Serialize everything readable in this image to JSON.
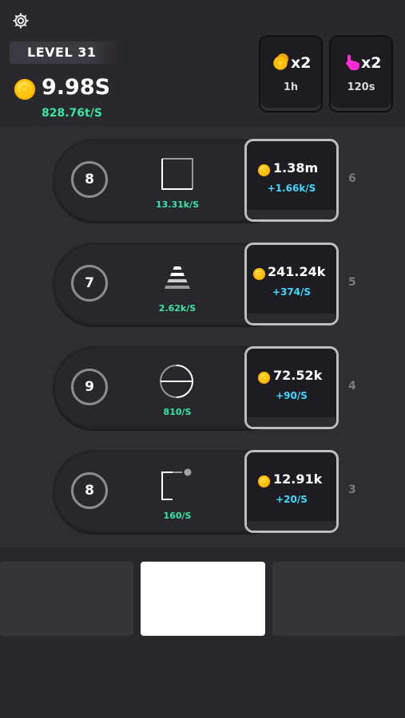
{
  "header": {
    "level": "LEVEL 31",
    "money": "9.98S",
    "rate": "828.76t/S"
  },
  "boosts": [
    {
      "multiplier": "x2",
      "time": "1h",
      "icon": "coin-stack-icon"
    },
    {
      "multiplier": "x2",
      "time": "120s",
      "icon": "tap-hand-icon"
    }
  ],
  "rows": [
    {
      "count": "8",
      "rate": "13.31k/S",
      "price": "1.38m",
      "gain": "+1.66k/S",
      "index": "6",
      "icon": "square-outline-icon"
    },
    {
      "count": "7",
      "rate": "2.62k/S",
      "price": "241.24k",
      "gain": "+374/S",
      "index": "5",
      "icon": "pyramid-stripes-icon"
    },
    {
      "count": "9",
      "rate": "810/S",
      "price": "72.52k",
      "gain": "+90/S",
      "index": "4",
      "icon": "circle-line-icon"
    },
    {
      "count": "8",
      "rate": "160/S",
      "price": "12.91k",
      "gain": "+20/S",
      "index": "3",
      "icon": "bracket-dot-icon"
    }
  ],
  "colors": {
    "accent_green": "#39e6a6",
    "accent_blue": "#3fd7ff",
    "coin": "#ffc400",
    "tap": "#ff2bd6"
  }
}
